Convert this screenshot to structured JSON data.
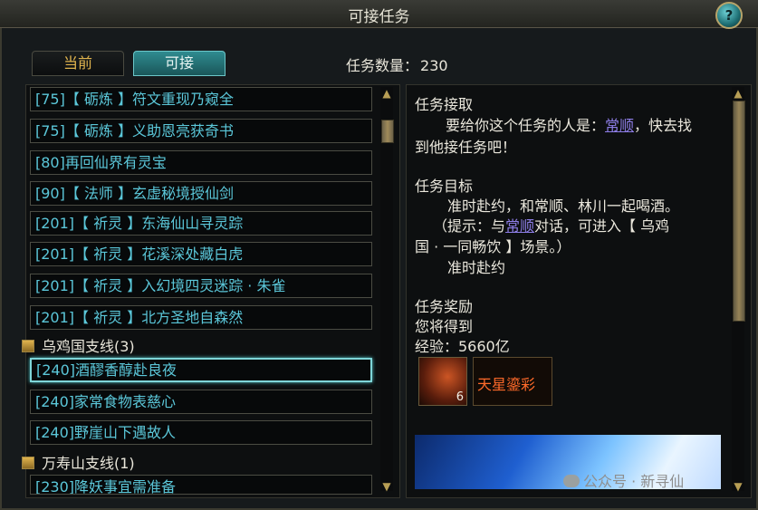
{
  "window": {
    "title": "可接任务",
    "help_label": "?"
  },
  "tabs": [
    {
      "label": "当前"
    },
    {
      "label": "可接"
    }
  ],
  "task_count": {
    "label": "任务数量：",
    "value": "230"
  },
  "list": {
    "items": [
      "[75]【 砺炼 】符文重现乃窥全",
      "[75]【 砺炼 】义助恩亮获奇书",
      "[80]再回仙界有灵宝",
      "[90]【 法师 】玄虚秘境授仙剑",
      "[201]【 祈灵 】东海仙山寻灵踪",
      "[201]【 祈灵 】花溪深处藏白虎",
      "[201]【 祈灵 】入幻境四灵迷踪 · 朱雀",
      "[201]【 祈灵 】北方圣地自森然"
    ],
    "group1": "乌鸡国支线(3)",
    "group1_items": [
      "[240]酒醪香醇赴良夜",
      "[240]家常食物表慈心",
      "[240]野崖山下遇故人"
    ],
    "group2": "万寿山支线(1)",
    "group2_items": [
      "[230]降妖事宜需准备"
    ]
  },
  "detail": {
    "receive_heading": "任务接取",
    "receive_line1_pre": "要给你这个任务的人是：",
    "receive_link": "常顺",
    "receive_line1_post": "，快去找",
    "receive_line2": "到他接任务吧！",
    "goal_heading": "任务目标",
    "goal_line1": "准时赴约，和常顺、林川一起喝酒。",
    "goal_line2_pre": "（提示：与",
    "goal_line2_link": "常顺",
    "goal_line2_post": "对话，可进入【 乌鸡",
    "goal_line3": "国 · 一同畅饮 】场景。）",
    "goal_line4": "准时赴约",
    "reward_heading": "任务奖励",
    "reward_you_get": "您将得到",
    "reward_exp": "经验：5660亿",
    "reward_item": {
      "name": "天星鎏彩",
      "qty": "6"
    }
  },
  "watermark": "公众号 · 新寻仙",
  "colors": {
    "quest_text": "#5bc7d9",
    "link": "#8d7de6",
    "reward_name": "#ff6a2a",
    "tab_active": "#2f8b90"
  }
}
